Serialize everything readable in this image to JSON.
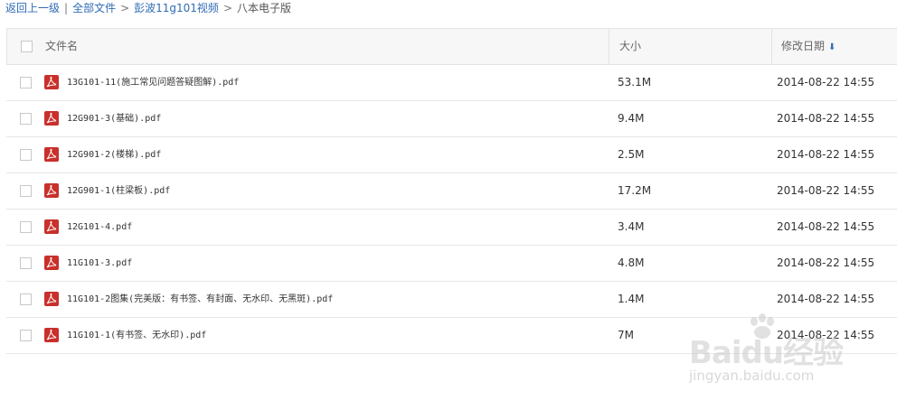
{
  "breadcrumb": {
    "back": "返回上一级",
    "divider": "|",
    "all_files": "全部文件",
    "folder": "彭波11g101视频",
    "current": "八本电子版",
    "sep": ">"
  },
  "table": {
    "headers": {
      "name": "文件名",
      "size": "大小",
      "date": "修改日期"
    },
    "sort_icon": "arrow-down-icon",
    "rows": [
      {
        "name": "13G101-11(施工常见问题答疑图解).pdf",
        "size": "53.1M",
        "date": "2014-08-22 14:55"
      },
      {
        "name": "12G901-3(基础).pdf",
        "size": "9.4M",
        "date": "2014-08-22 14:55"
      },
      {
        "name": "12G901-2(楼梯).pdf",
        "size": "2.5M",
        "date": "2014-08-22 14:55"
      },
      {
        "name": "12G901-1(柱梁板).pdf",
        "size": "17.2M",
        "date": "2014-08-22 14:55"
      },
      {
        "name": "12G101-4.pdf",
        "size": "3.4M",
        "date": "2014-08-22 14:55"
      },
      {
        "name": "11G101-3.pdf",
        "size": "4.8M",
        "date": "2014-08-22 14:55"
      },
      {
        "name": "11G101-2图集(完美版：有书签、有封面、无水印、无黑斑).pdf",
        "size": "1.4M",
        "date": "2014-08-22 14:55"
      },
      {
        "name": "11G101-1(有书签、无水印).pdf",
        "size": "7M",
        "date": "2014-08-22 14:55"
      }
    ]
  },
  "watermark": {
    "logo": "Baidu经验",
    "sub": "jingyan.baidu.com"
  },
  "colors": {
    "link": "#2f6bb5",
    "pdf": "#c9302c",
    "header_bg": "#f7f7f7"
  }
}
